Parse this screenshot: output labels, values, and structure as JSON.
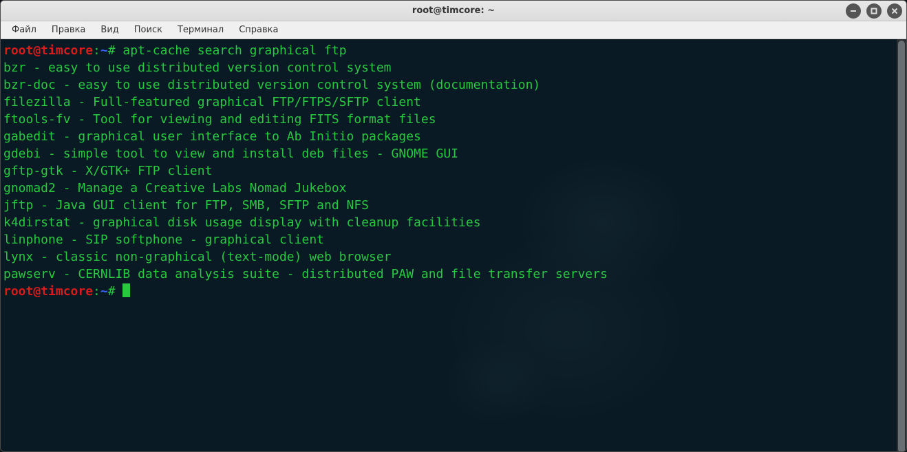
{
  "window": {
    "title": "root@timcore: ~"
  },
  "menubar": {
    "items": [
      "Файл",
      "Правка",
      "Вид",
      "Поиск",
      "Терминал",
      "Справка"
    ]
  },
  "prompt": {
    "userhost": "root@timcore",
    "sep": ":",
    "path": "~",
    "hash": "#"
  },
  "command1": "apt-cache search graphical ftp",
  "output_lines": [
    "bzr - easy to use distributed version control system",
    "bzr-doc - easy to use distributed version control system (documentation)",
    "filezilla - Full-featured graphical FTP/FTPS/SFTP client",
    "ftools-fv - Tool for viewing and editing FITS format files",
    "gabedit - graphical user interface to Ab Initio packages",
    "gdebi - simple tool to view and install deb files - GNOME GUI",
    "gftp-gtk - X/GTK+ FTP client",
    "gnomad2 - Manage a Creative Labs Nomad Jukebox",
    "jftp - Java GUI client for FTP, SMB, SFTP and NFS",
    "k4dirstat - graphical disk usage display with cleanup facilities",
    "linphone - SIP softphone - graphical client",
    "lynx - classic non-graphical (text-mode) web browser",
    "pawserv - CERNLIB data analysis suite - distributed PAW and file transfer servers"
  ],
  "colors": {
    "terminal_bg": "#0a1a24",
    "text_green": "#28c840",
    "prompt_red": "#d81b1b",
    "prompt_blue": "#3a64ff"
  }
}
